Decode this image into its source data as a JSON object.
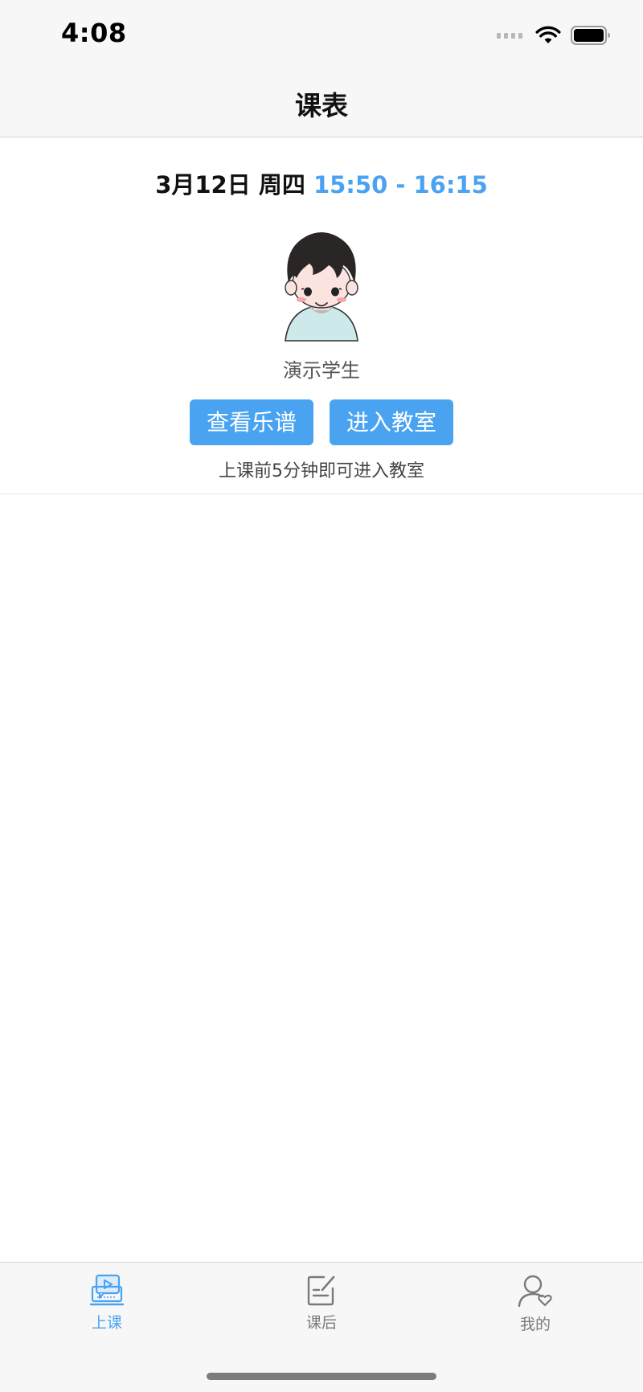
{
  "status_bar": {
    "time": "4:08",
    "icons": [
      "cellular-signal-icon",
      "wifi-icon",
      "battery-icon"
    ]
  },
  "nav": {
    "title": "课表"
  },
  "lesson": {
    "date": "3月12日 周四",
    "time_range": "15:50 - 16:15",
    "student_name": "演示学生",
    "view_score_label": "查看乐谱",
    "enter_classroom_label": "进入教室",
    "hint": "上课前5分钟即可进入教室"
  },
  "tab_bar": {
    "tabs": [
      {
        "label": "上课",
        "icon": "classroom-video-icon",
        "active": true
      },
      {
        "label": "课后",
        "icon": "notebook-edit-icon",
        "active": false
      },
      {
        "label": "我的",
        "icon": "user-heart-icon",
        "active": false
      }
    ]
  },
  "colors": {
    "accent": "#4aa3f1",
    "inactive_tab": "#7a7a7a",
    "bar_background": "#f7f7f7"
  }
}
